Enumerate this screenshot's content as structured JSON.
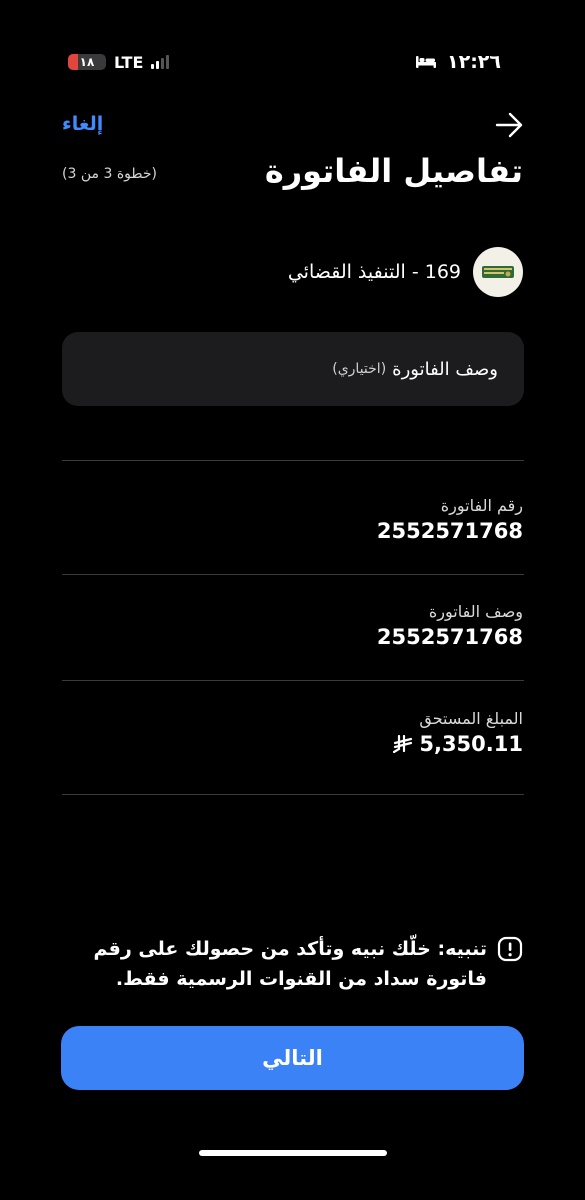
{
  "status_bar": {
    "battery_level": "١٨",
    "battery_fraction": 0.18,
    "network": "LTE",
    "time": "١٢:٢٦"
  },
  "nav": {
    "cancel_label": "إلغاء",
    "back_icon": "arrow-right-icon"
  },
  "title": "تفاصيل الفاتورة",
  "step": "(خطوة 3 من 3)",
  "biller": {
    "name": "169 - التنفيذ القضائي",
    "logo_icon": "judicial-execution-logo"
  },
  "description_input": {
    "label": "وصف الفاتورة",
    "optional": "(اختياري)"
  },
  "fields": [
    {
      "label": "رقم الفاتورة",
      "value": "2552571768"
    },
    {
      "label": "وصف الفاتورة",
      "value": "2552571768"
    },
    {
      "label": "المبلغ المستحق",
      "value": "5,350.11",
      "currency_icon": "sar-currency-icon"
    }
  ],
  "warning": {
    "icon": "exclamation-icon",
    "text": "تنبيه: خلّك نبيه وتأكد من حصولك على رقم فاتورة سداد من القنوات الرسمية فقط."
  },
  "next_button_label": "التالي",
  "colors": {
    "accent": "#3b82f6",
    "link": "#3f8cff",
    "background": "#000000",
    "card": "#1c1c1e"
  }
}
